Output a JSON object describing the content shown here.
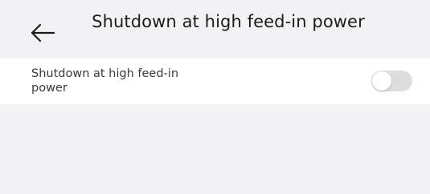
{
  "header": {
    "back_icon": "arrow-left-icon",
    "title": "Shutdown at high feed-in power"
  },
  "setting": {
    "label": "Shutdown at high feed-in power",
    "enabled": false
  },
  "colors": {
    "background": "#f2f2f4",
    "row_background": "#ffffff",
    "toggle_off": "#dcdcdc",
    "text_primary": "#1b1b1b",
    "text_secondary": "#3a3a3a"
  }
}
